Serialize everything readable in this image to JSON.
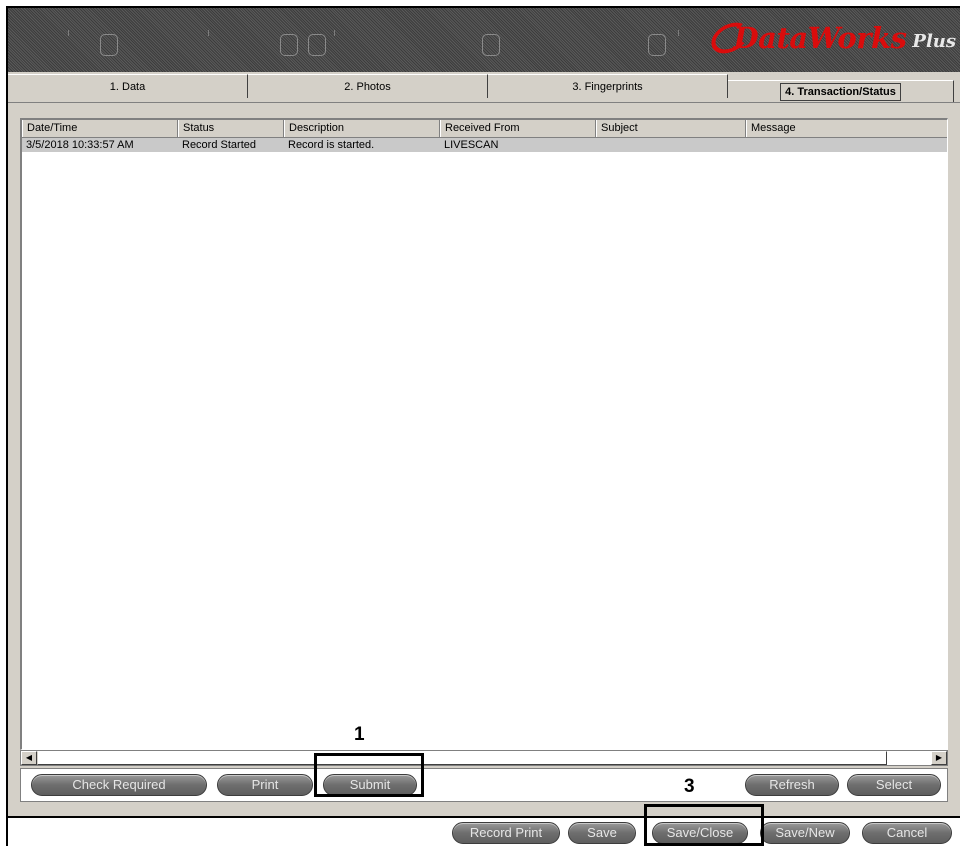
{
  "app": {
    "logo_text": "DataWorks",
    "logo_suffix": "Plus"
  },
  "tabs": [
    {
      "label": "1. Data",
      "active": false
    },
    {
      "label": "2. Photos",
      "active": false
    },
    {
      "label": "3. Fingerprints",
      "active": false
    },
    {
      "label": "4. Transaction/Status",
      "active": true
    }
  ],
  "table": {
    "columns": [
      "Date/Time",
      "Status",
      "Description",
      "Received From",
      "Subject",
      "Message"
    ],
    "rows": [
      [
        "3/5/2018 10:33:57 AM",
        "Record Started",
        "Record is started.",
        "LIVESCAN",
        "",
        ""
      ]
    ]
  },
  "panel_actions": {
    "check_required": "Check Required",
    "print": "Print",
    "submit": "Submit",
    "refresh": "Refresh",
    "select": "Select"
  },
  "footer_actions": {
    "record_print": "Record Print",
    "save": "Save",
    "save_close": "Save/Close",
    "save_new": "Save/New",
    "cancel": "Cancel"
  },
  "callouts": {
    "submit_number": "1",
    "save_close_number": "3"
  },
  "colors": {
    "brand": "#d90c0c",
    "header_bg": "#4a4a4a",
    "chrome": "#d4d0c8",
    "row_highlight": "#c9c9c9"
  }
}
